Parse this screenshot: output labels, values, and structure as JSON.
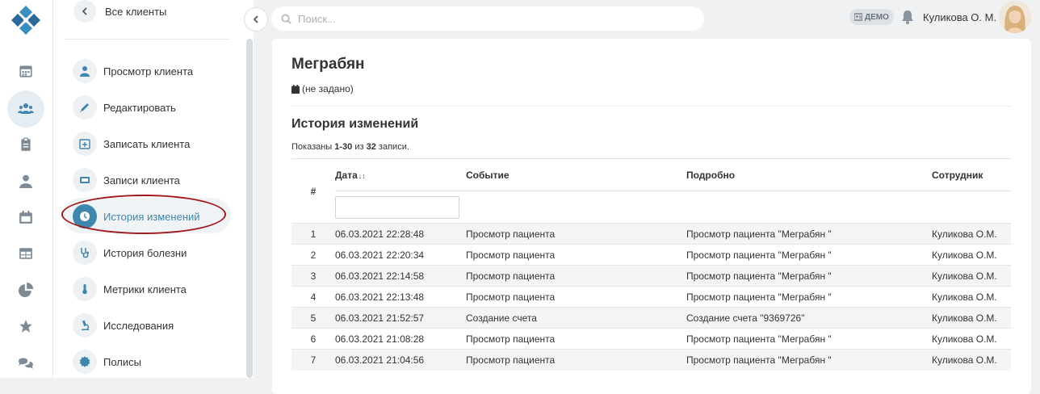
{
  "colors": {
    "accent": "#3f86ae",
    "highlight_ellipse": "#a0181c"
  },
  "rail": {
    "items": [
      {
        "icon": "calendar-icon"
      },
      {
        "icon": "users-icon",
        "active": true
      },
      {
        "icon": "clipboard-icon"
      },
      {
        "icon": "doctor-icon"
      },
      {
        "icon": "schedule-icon"
      },
      {
        "icon": "table-icon"
      },
      {
        "icon": "pie-chart-icon"
      },
      {
        "icon": "star-icon"
      },
      {
        "icon": "chat-icon"
      }
    ]
  },
  "submenu": {
    "back_label": "Все клиенты",
    "items": [
      {
        "label": "Просмотр клиента",
        "icon": "user-icon"
      },
      {
        "label": "Редактировать",
        "icon": "pencil-icon"
      },
      {
        "label": "Записать клиента",
        "icon": "calendar-plus-icon"
      },
      {
        "label": "Записи клиента",
        "icon": "ticket-icon"
      },
      {
        "label": "История изменений",
        "icon": "clock-icon",
        "active": true
      },
      {
        "label": "История болезни",
        "icon": "stethoscope-icon"
      },
      {
        "label": "Метрики клиента",
        "icon": "thermometer-icon"
      },
      {
        "label": "Исследования",
        "icon": "microscope-icon"
      },
      {
        "label": "Полисы",
        "icon": "badge-icon"
      }
    ]
  },
  "topbar": {
    "search_placeholder": "Поиск...",
    "demo_label": "ДЕМО",
    "user_name": "Куликова О. М."
  },
  "client": {
    "name": "Меграбян",
    "birthdate": "(не задано)"
  },
  "history": {
    "title": "История изменений",
    "summary_prefix": "Показаны ",
    "summary_range": "1-30",
    "summary_mid": " из ",
    "summary_total": "32",
    "summary_suffix": " записи.",
    "columns": {
      "num": "#",
      "date": "Дата",
      "event": "Событие",
      "detail": "Подробно",
      "employee": "Сотрудник"
    },
    "rows": [
      {
        "num": "1",
        "date": "06.03.2021 22:28:48",
        "event": "Просмотр пациента",
        "detail": "Просмотр пациента \"Меграбян \"",
        "employee": "Куликова О.М."
      },
      {
        "num": "2",
        "date": "06.03.2021 22:20:34",
        "event": "Просмотр пациента",
        "detail": "Просмотр пациента \"Меграбян \"",
        "employee": "Куликова О.М."
      },
      {
        "num": "3",
        "date": "06.03.2021 22:14:58",
        "event": "Просмотр пациента",
        "detail": "Просмотр пациента \"Меграбян \"",
        "employee": "Куликова О.М."
      },
      {
        "num": "4",
        "date": "06.03.2021 22:13:48",
        "event": "Просмотр пациента",
        "detail": "Просмотр пациента \"Меграбян \"",
        "employee": "Куликова О.М."
      },
      {
        "num": "5",
        "date": "06.03.2021 21:52:57",
        "event": "Создание счета",
        "detail": "Создание счета \"9369726\"",
        "employee": "Куликова О.М."
      },
      {
        "num": "6",
        "date": "06.03.2021 21:08:28",
        "event": "Просмотр пациента",
        "detail": "Просмотр пациента \"Меграбян \"",
        "employee": "Куликова О.М."
      },
      {
        "num": "7",
        "date": "06.03.2021 21:04:56",
        "event": "Просмотр пациента",
        "detail": "Просмотр пациента \"Меграбян \"",
        "employee": "Куликова О.М."
      }
    ]
  }
}
